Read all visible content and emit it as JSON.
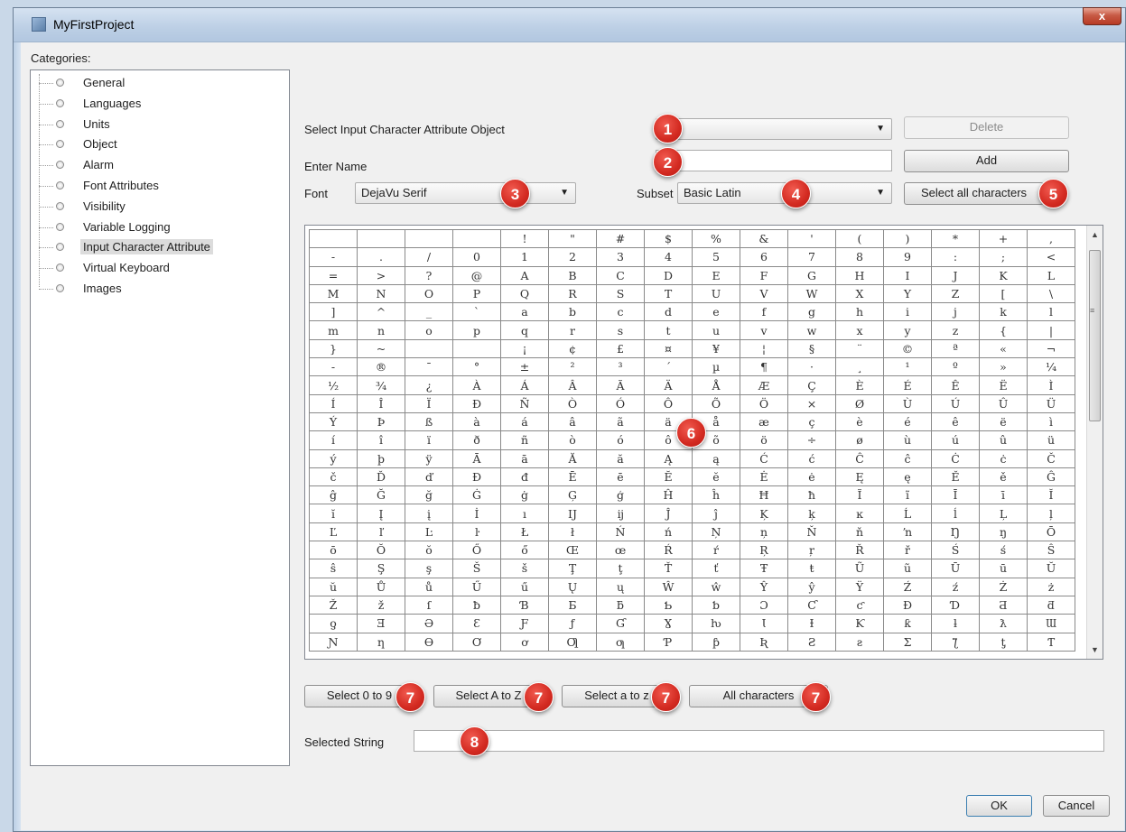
{
  "window": {
    "title": "MyFirstProject",
    "close_label": "x"
  },
  "categories": {
    "label": "Categories:",
    "items": [
      "General",
      "Languages",
      "Units",
      "Object",
      "Alarm",
      "Font Attributes",
      "Visibility",
      "Variable Logging",
      "Input Character Attribute",
      "Virtual Keyboard",
      "Images"
    ],
    "selected": "Input Character Attribute"
  },
  "form": {
    "select_object_label": "Select Input Character Attribute Object",
    "select_object_value": "",
    "delete_label": "Delete",
    "enter_name_label": "Enter Name",
    "name_value": "",
    "add_label": "Add",
    "font_label": "Font",
    "font_value": "DejaVu Serif",
    "subset_label": "Subset",
    "subset_value": "Basic Latin",
    "select_all_label": "Select all characters",
    "selected_string_label": "Selected String",
    "selected_string_value": ""
  },
  "char_grid": {
    "rows": [
      [
        "",
        "",
        "",
        "",
        "!",
        "\"",
        "#",
        "$",
        "%",
        "&",
        "'",
        "(",
        ")",
        "*",
        "+",
        ","
      ],
      [
        "-",
        ".",
        "/",
        "0",
        "1",
        "2",
        "3",
        "4",
        "5",
        "6",
        "7",
        "8",
        "9",
        ":",
        ";",
        "<"
      ],
      [
        "=",
        ">",
        "?",
        "@",
        "A",
        "B",
        "C",
        "D",
        "E",
        "F",
        "G",
        "H",
        "I",
        "J",
        "K",
        "L"
      ],
      [
        "M",
        "N",
        "O",
        "P",
        "Q",
        "R",
        "S",
        "T",
        "U",
        "V",
        "W",
        "X",
        "Y",
        "Z",
        "[",
        "\\"
      ],
      [
        "]",
        "^",
        "_",
        "`",
        "a",
        "b",
        "c",
        "d",
        "e",
        "f",
        "g",
        "h",
        "i",
        "j",
        "k",
        "l"
      ],
      [
        "m",
        "n",
        "o",
        "p",
        "q",
        "r",
        "s",
        "t",
        "u",
        "v",
        "w",
        "x",
        "y",
        "z",
        "{",
        "|"
      ],
      [
        "}",
        "~",
        "",
        "",
        "¡",
        "¢",
        "£",
        "¤",
        "¥",
        "¦",
        "§",
        "¨",
        "©",
        "ª",
        "«",
        "¬"
      ],
      [
        "-",
        "®",
        "¯",
        "°",
        "±",
        "²",
        "³",
        "´",
        "µ",
        "¶",
        "·",
        "¸",
        "¹",
        "º",
        "»",
        "¼"
      ],
      [
        "½",
        "¾",
        "¿",
        "À",
        "Á",
        "Â",
        "Ã",
        "Ä",
        "Å",
        "Æ",
        "Ç",
        "È",
        "É",
        "Ê",
        "Ë",
        "Ì"
      ],
      [
        "Í",
        "Î",
        "Ï",
        "Ð",
        "Ñ",
        "Ò",
        "Ó",
        "Ô",
        "Õ",
        "Ö",
        "×",
        "Ø",
        "Ù",
        "Ú",
        "Û",
        "Ü"
      ],
      [
        "Ý",
        "Þ",
        "ß",
        "à",
        "á",
        "â",
        "ã",
        "ä",
        "å",
        "æ",
        "ç",
        "è",
        "é",
        "ê",
        "ë",
        "ì"
      ],
      [
        "í",
        "î",
        "ï",
        "ð",
        "ñ",
        "ò",
        "ó",
        "ô",
        "õ",
        "ö",
        "÷",
        "ø",
        "ù",
        "ú",
        "û",
        "ü"
      ],
      [
        "ý",
        "þ",
        "ÿ",
        "Ā",
        "ā",
        "Ă",
        "ă",
        "Ą",
        "ą",
        "Ć",
        "ć",
        "Ĉ",
        "ĉ",
        "Ċ",
        "ċ",
        "Č"
      ],
      [
        "č",
        "Ď",
        "ď",
        "Đ",
        "đ",
        "Ē",
        "ē",
        "Ĕ",
        "ĕ",
        "Ė",
        "ė",
        "Ę",
        "ę",
        "Ě",
        "ě",
        "Ĝ"
      ],
      [
        "ĝ",
        "Ğ",
        "ğ",
        "Ġ",
        "ġ",
        "Ģ",
        "ģ",
        "Ĥ",
        "ĥ",
        "Ħ",
        "ħ",
        "Ĩ",
        "ĩ",
        "Ī",
        "ī",
        "Ĭ"
      ],
      [
        "ĭ",
        "Į",
        "į",
        "İ",
        "ı",
        "Ĳ",
        "ĳ",
        "Ĵ",
        "ĵ",
        "Ķ",
        "ķ",
        "ĸ",
        "Ĺ",
        "ĺ",
        "Ļ",
        "ļ"
      ],
      [
        "Ľ",
        "ľ",
        "Ŀ",
        "ŀ",
        "Ł",
        "ł",
        "Ń",
        "ń",
        "Ņ",
        "ņ",
        "Ň",
        "ň",
        "ŉ",
        "Ŋ",
        "ŋ",
        "Ō"
      ],
      [
        "ō",
        "Ŏ",
        "ŏ",
        "Ő",
        "ő",
        "Œ",
        "œ",
        "Ŕ",
        "ŕ",
        "Ŗ",
        "ŗ",
        "Ř",
        "ř",
        "Ś",
        "ś",
        "Ŝ"
      ],
      [
        "ŝ",
        "Ş",
        "ş",
        "Š",
        "š",
        "Ţ",
        "ţ",
        "Ť",
        "ť",
        "Ŧ",
        "ŧ",
        "Ũ",
        "ũ",
        "Ū",
        "ū",
        "Ŭ"
      ],
      [
        "ŭ",
        "Ů",
        "ů",
        "Ű",
        "ű",
        "Ų",
        "ų",
        "Ŵ",
        "ŵ",
        "Ŷ",
        "ŷ",
        "Ÿ",
        "Ź",
        "ź",
        "Ż",
        "ż"
      ],
      [
        "Ž",
        "ž",
        "ſ",
        "ƀ",
        "Ɓ",
        "Ƃ",
        "ƃ",
        "Ƅ",
        "ƅ",
        "Ɔ",
        "Ƈ",
        "ƈ",
        "Ɖ",
        "Ɗ",
        "Ƌ",
        "ƌ"
      ],
      [
        "ƍ",
        "Ǝ",
        "Ə",
        "Ɛ",
        "Ƒ",
        "ƒ",
        "Ɠ",
        "Ɣ",
        "ƕ",
        "Ɩ",
        "Ɨ",
        "Ƙ",
        "ƙ",
        "ƚ",
        "ƛ",
        "Ɯ"
      ],
      [
        "Ɲ",
        "ƞ",
        "Ɵ",
        "Ơ",
        "ơ",
        "Ƣ",
        "ƣ",
        "Ƥ",
        "ƥ",
        "Ʀ",
        "Ƨ",
        "ƨ",
        "Ʃ",
        "ƪ",
        "ƫ",
        "Ƭ"
      ]
    ]
  },
  "quick_select": {
    "digits_label": "Select 0 to 9",
    "upper_label": "Select A to Z",
    "lower_label": "Select a to z",
    "all_label": "All characters"
  },
  "markers": {
    "object_combo": "1",
    "name_field": "2",
    "font_combo": "3",
    "subset_combo": "4",
    "select_all": "5",
    "char_grid": "6",
    "quick_buttons": "7",
    "selected_string": "8"
  },
  "dialog_buttons": {
    "ok_label": "OK",
    "cancel_label": "Cancel"
  },
  "colors": {
    "marker": "#d32a21",
    "titlebar": "#bccfe5",
    "close": "#c75a45"
  }
}
